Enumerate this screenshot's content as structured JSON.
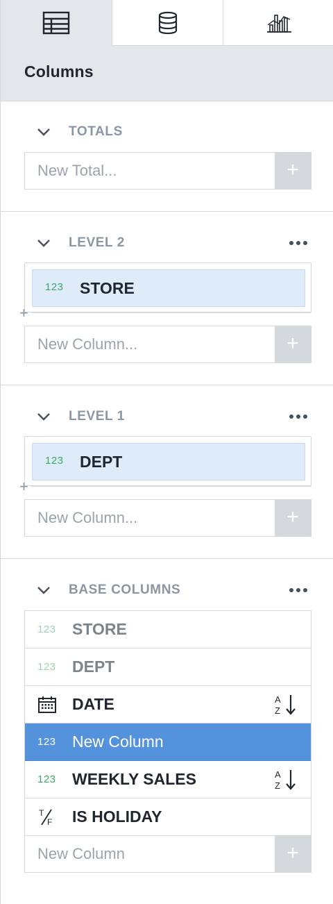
{
  "tabs": [
    {
      "icon": "table-icon",
      "active": true
    },
    {
      "icon": "database-icon",
      "active": false
    },
    {
      "icon": "chart-icon",
      "active": false
    }
  ],
  "header": {
    "title": "Columns"
  },
  "sections": {
    "totals": {
      "label": "TOTALS",
      "add_placeholder": "New Total...",
      "add_button": "+"
    },
    "level2": {
      "label": "LEVEL 2",
      "chip": {
        "type": "123",
        "name": "STORE"
      },
      "drop_plus": "+",
      "add_placeholder": "New Column...",
      "add_button": "+"
    },
    "level1": {
      "label": "LEVEL 1",
      "chip": {
        "type": "123",
        "name": "DEPT"
      },
      "drop_plus": "+",
      "add_placeholder": "New Column...",
      "add_button": "+"
    },
    "base": {
      "label": "BASE COLUMNS",
      "rows": [
        {
          "type": "123",
          "name": "STORE",
          "state": "dimmed"
        },
        {
          "type": "123",
          "name": "DEPT",
          "state": "dimmed"
        },
        {
          "type": "calendar-icon",
          "name": "DATE",
          "sort": "A Z sort-icon"
        },
        {
          "type": "123",
          "name": "New Column",
          "state": "selected"
        },
        {
          "type": "123",
          "name": "WEEKLY SALES",
          "sort": "A Z sort-icon"
        },
        {
          "type": "T/F",
          "name": "IS HOLIDAY"
        }
      ],
      "add_placeholder": "New Column",
      "add_button": "+"
    }
  },
  "colors": {
    "selected_row": "#5592dc",
    "chip_bg": "#deebf9",
    "type_green": "#3fa66a",
    "panel_bg": "#e3e7ea"
  }
}
